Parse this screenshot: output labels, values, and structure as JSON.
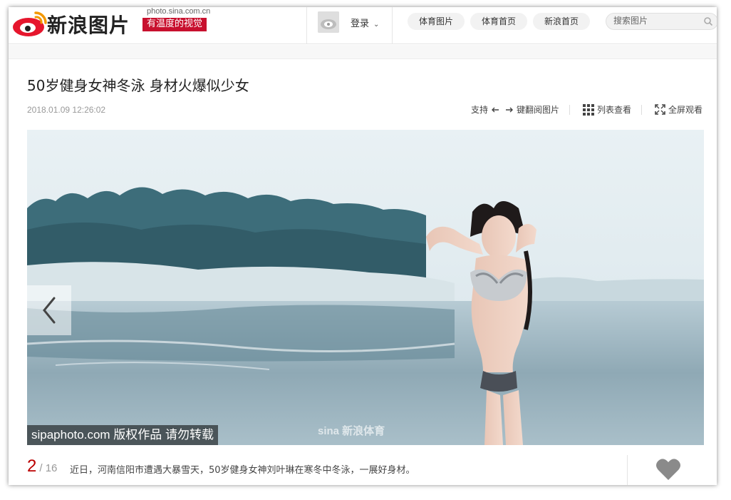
{
  "header": {
    "brand": "新浪图片",
    "domain": "photo.sina.com.cn",
    "slogan": "有温度的视觉",
    "login_label": "登录",
    "nav": [
      "体育图片",
      "体育首页",
      "新浪首页"
    ],
    "search_placeholder": "搜索图片"
  },
  "article": {
    "title": "50岁健身女神冬泳 身材火爆似少女",
    "date": "2018.01.09 12:26:02"
  },
  "toolbar": {
    "support_prefix": "支持",
    "support_suffix": "键翻阅图片",
    "list_view": "列表查看",
    "fullscreen": "全屏观看"
  },
  "photo": {
    "watermark": "sipaphoto.com 版权作品  请勿转载",
    "sina_mark": "sina 新浪体育"
  },
  "footer": {
    "current": "2",
    "total": "/ 16",
    "caption": "近日，河南信阳市遭遇大暴雪天，50岁健身女神刘叶琳在寒冬中冬泳，一展好身材。"
  },
  "colors": {
    "brand_red": "#c8102e",
    "counter_red": "#b00000",
    "water": "#9fb8c4",
    "sky": "#e4edf1"
  }
}
